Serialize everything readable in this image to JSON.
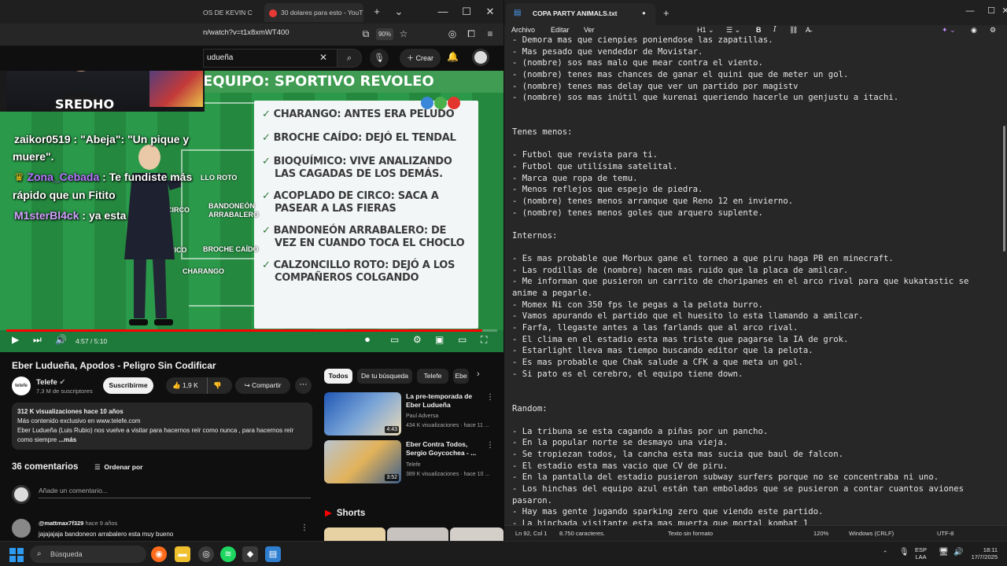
{
  "browser": {
    "tabs": [
      {
        "label": "OS DE KEVIN C"
      },
      {
        "label": "30 dolares para esto - YouT"
      }
    ],
    "new_tab": "+",
    "url": "n/watch?v=t1x8xmWT400",
    "zoom": "90%"
  },
  "youtube": {
    "search_value": "udueña",
    "create_label": "Crear",
    "video": {
      "header": "EQUIPO: SPORTIVO REVOLEO",
      "board_items": [
        "CHARANGO: ANTES ERA PELUDO",
        "BROCHE CAÍDO: DEJÓ EL TENDAL",
        "BIOQUÍMICO: VIVE ANALIZANDO",
        "LAS CAGADAS DE LOS DEMÁS.",
        "ACOPLADO DE CIRCO: SACA A",
        "PASEAR A LAS FIERAS",
        "BANDONEÓN ARRABALERO: DE",
        "VEZ EN CUANDO TOCA EL CHOCLO",
        "CALZONCILLO ROTO: DEJÓ A LOS",
        "COMPAÑEROS COLGANDO"
      ],
      "pitch_labels": [
        {
          "text": "LLO ROTO"
        },
        {
          "text": "CIRCO"
        },
        {
          "text": "BANDONEÓN"
        },
        {
          "text": "ARRABALERO"
        },
        {
          "text": "MICO"
        },
        {
          "text": "BROCHE CAÍDO"
        },
        {
          "text": "CHARANGO"
        }
      ],
      "time_current": "4:57",
      "time_total": "5:10",
      "progress": 0.97
    },
    "stream_overlay": {
      "cam_text": "SREDHO",
      "chat": [
        {
          "user": "zaikor0519",
          "sep": " : ",
          "message": "\"Abeja\": \"Un pique y"
        },
        {
          "user": "",
          "sep": "",
          "message": "muere\"."
        },
        {
          "user": "Zona_Cebada",
          "sep": " : ",
          "message": "Te fundiste más"
        },
        {
          "user": "",
          "sep": "",
          "message": "rápido que un Fitito"
        },
        {
          "user": "M1sterBl4ck",
          "sep": " : ",
          "message": "ya esta"
        }
      ]
    },
    "title": "Eber Ludueña, Apodos - Peligro Sin Codificar",
    "channel": {
      "name": "Telefe",
      "subs": "7,3 M de suscriptores",
      "avatar_text": "telefe"
    },
    "subscribe_label": "Suscribirme",
    "likes": "1,9 K",
    "share_label": "Compartir",
    "description": {
      "stats": "312 K visualizaciones  hace 10 años",
      "line1": "Más contenido exclusivo en www.telefe.com",
      "line2": "Eber Ludueña (Luis Rubio) nos vuelve a visitar para hacernos reír como nunca , para hacernos reír",
      "line3": "como siempre",
      "more": "...más"
    },
    "comments": {
      "title": "36 comentarios",
      "sort_label": "Ordenar por",
      "add_placeholder": "Añade un comentario...",
      "first": {
        "user": "@mattmax7f329",
        "time": "hace 9 años",
        "text": "jajajajaja  bandoneon arrabalero  esta muy bueno"
      }
    },
    "chips": [
      "Todos",
      "De tu búsqueda",
      "Telefe",
      "Ebe"
    ],
    "recommendations": [
      {
        "title": "La pre-temporada de Eber Ludueña",
        "channel": "Paul Adversa",
        "meta": "434 K visualizaciones · hace 11 ...",
        "duration": "4:43"
      },
      {
        "title": "Eber Contra Todos, Sergio Goycochea - ...",
        "channel": "Telefe",
        "meta": "389 K visualizaciones · hace 10 ...",
        "duration": "3:52"
      }
    ],
    "shorts_label": "Shorts"
  },
  "notepad": {
    "tab_title": "COPA PARTY ANIMALS.txt",
    "menu": [
      "Archivo",
      "Editar",
      "Ver"
    ],
    "heading_tool": "H1",
    "lines": [
      "- Demora mas que cienpies poniendose las zapatillas.",
      "- Mas pesado que vendedor de Movistar.",
      "- (nombre) sos mas malo que mear contra el viento.",
      "- (nombre) tenes mas chances de ganar el quini que de meter un gol.",
      "- (nombre) tenes mas delay que ver un partido por magistv",
      "- (nombre) sos mas inútil que kurenai queriendo hacerle un genjustu a itachi.",
      "",
      "",
      "Tenes menos:",
      "",
      "- Futbol que revista para ti.",
      "- Futbol que utilísima satelital.",
      "- Marca que ropa de temu.",
      "- Menos reflejos que espejo de piedra.",
      "- (nombre) tenes menos arranque que Reno 12 en invierno.",
      "- (nombre) tenes menos goles que arquero suplente.",
      "",
      "Internos:",
      "",
      "- Es mas probable que Morbux gane el torneo a que piru haga PB en minecraft.",
      "- Las rodillas de (nombre) hacen mas ruido que la placa de amilcar.",
      "- Me informan que pusieron un carrito de choripanes en el arco rival para que kukatastic se",
      "anime a pegarle.",
      "- Momex Ni con 350 fps le pegas a la pelota burro.",
      "- Vamos apurando el partido que el huesito lo esta llamando a amilcar.",
      "- Farfa, llegaste antes a las farlands que al arco rival.",
      "- El clima en el estadio esta mas triste que pagarse la IA de grok.",
      "- Estarlight lleva mas tiempo buscando editor que la pelota.",
      "- Es mas probable que Chak salude a CFK a que meta un gol.",
      "- Si pato es el cerebro, el equipo tiene down.",
      "",
      "",
      "Random:",
      "",
      "- La tribuna se esta cagando a piñas por un pancho.",
      "- En la popular norte se desmayo una vieja.",
      "- Se tropiezan todos, la cancha esta mas sucia que baul de falcon.",
      "- El estadio esta mas vacio que CV de piru.",
      "- En la pantalla del estadio pusieron subway surfers porque no se concentraba ni uno.",
      "- Los hinchas del equipo azul están tan embolados que se pusieron a contar cuantos aviones",
      "pasaron.",
      "- Hay mas gente jugando sparking zero que viendo este partido.",
      "- La hinchada visitante esta mas muerta que mortal kombat 1"
    ],
    "status": {
      "position": "Ln 92, Col 1",
      "chars": "8.750 caracteres.",
      "format": "Texto sin formato",
      "zoom": "120%",
      "line_ending": "Windows (CRLF)",
      "encoding": "UTF-8"
    }
  },
  "taskbar": {
    "search_label": "Búsqueda",
    "lang_top": "ESP",
    "lang_bottom": "LAA",
    "time": "18:11",
    "date": "17/7/2025"
  },
  "colors": {
    "yt_red": "#ff0000",
    "notepad_bg": "#272727",
    "accent_blue": "#2e9bf0"
  }
}
